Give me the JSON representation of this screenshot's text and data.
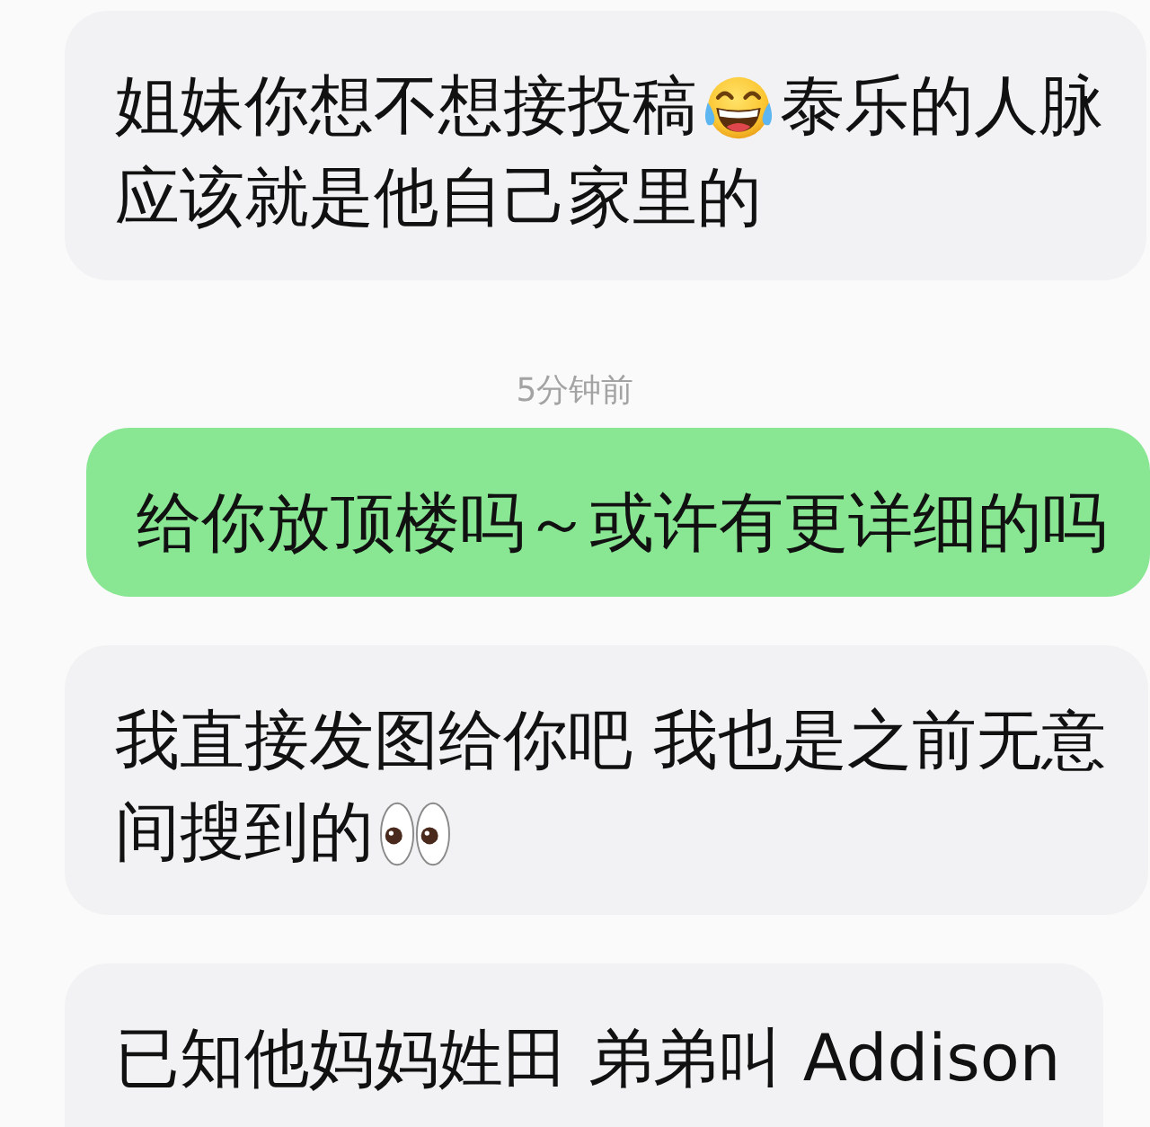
{
  "chat": [
    {
      "kind": "received",
      "lines": [
        {
          "segments": [
            {
              "kind": "text",
              "text": "姐妹你想不想接投稿"
            },
            {
              "kind": "laugh"
            },
            {
              "kind": "text",
              "text": "泰乐的人脉"
            }
          ]
        },
        {
          "segments": [
            {
              "kind": "text",
              "text": "应该就是他自己家里的"
            }
          ]
        }
      ]
    },
    {
      "kind": "time",
      "text": "5分钟前"
    },
    {
      "kind": "sent",
      "lines": [
        {
          "segments": [
            {
              "kind": "text",
              "text": "给你放顶楼吗～或许有更详细的吗"
            }
          ]
        }
      ]
    },
    {
      "kind": "received",
      "lines": [
        {
          "segments": [
            {
              "kind": "text",
              "text": "我直接发图给你吧 我也是之前无意"
            }
          ]
        },
        {
          "segments": [
            {
              "kind": "text",
              "text": "间搜到的"
            },
            {
              "kind": "eyes"
            }
          ]
        }
      ]
    },
    {
      "kind": "received",
      "lines": [
        {
          "segments": [
            {
              "kind": "text",
              "text": "已知他妈妈姓田 弟弟叫 Addison"
            }
          ]
        }
      ]
    }
  ]
}
